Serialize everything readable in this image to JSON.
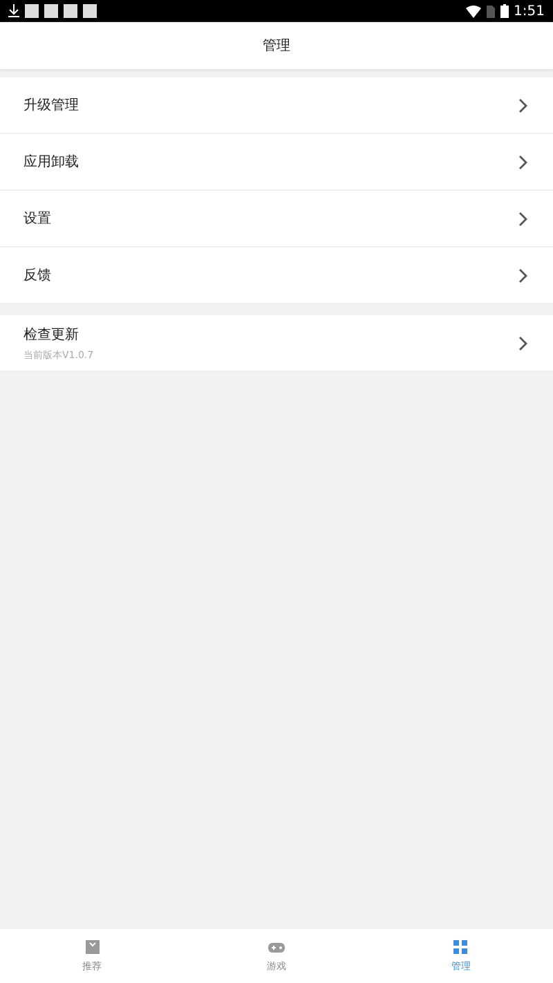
{
  "status_bar": {
    "time": "1:51"
  },
  "header": {
    "title": "管理"
  },
  "menu": [
    {
      "label": "升级管理"
    },
    {
      "label": "应用卸载"
    },
    {
      "label": "设置"
    },
    {
      "label": "反馈"
    }
  ],
  "update": {
    "label": "检查更新",
    "subtitle": "当前版本V1.0.7"
  },
  "nav": [
    {
      "label": "推荐",
      "selected": false
    },
    {
      "label": "游戏",
      "selected": false
    },
    {
      "label": "管理",
      "selected": true
    }
  ]
}
